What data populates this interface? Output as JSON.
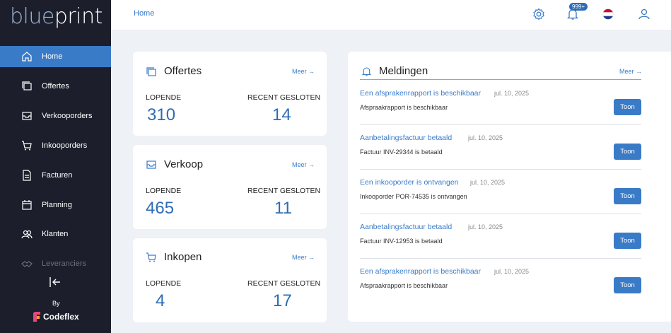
{
  "logo": {
    "part1": "blue",
    "part2": "print"
  },
  "sidebar": {
    "items": [
      {
        "label": "Home"
      },
      {
        "label": "Offertes"
      },
      {
        "label": "Verkooporders"
      },
      {
        "label": "Inkooporders"
      },
      {
        "label": "Facturen"
      },
      {
        "label": "Planning"
      },
      {
        "label": "Klanten"
      },
      {
        "label": "Leveranciers"
      }
    ],
    "by_label": "By",
    "brand": "Codeflex"
  },
  "topbar": {
    "breadcrumb": "Home",
    "notif_badge": "999+"
  },
  "cards": [
    {
      "title": "Offertes",
      "meer": "Meer",
      "open_label": "LOPENDE",
      "open_value": "310",
      "closed_label": "RECENT GESLOTEN",
      "closed_value": "14"
    },
    {
      "title": "Verkoop",
      "meer": "Meer",
      "open_label": "LOPENDE",
      "open_value": "465",
      "closed_label": "RECENT GESLOTEN",
      "closed_value": "11"
    },
    {
      "title": "Inkopen",
      "meer": "Meer",
      "open_label": "LOPENDE",
      "open_value": "4",
      "closed_label": "RECENT GESLOTEN",
      "closed_value": "17"
    }
  ],
  "notifications": {
    "title": "Meldingen",
    "meer": "Meer",
    "button_label": "Toon",
    "items": [
      {
        "head": "Een afsprakenrapport is beschikbaar",
        "date": "jul. 10, 2025",
        "desc": "Afspraakrapport is beschikbaar"
      },
      {
        "head": "Aanbetalingsfactuur betaald",
        "date": "jul. 10, 2025",
        "desc": "Factuur INV-29344 is betaald"
      },
      {
        "head": "Een inkooporder is ontvangen",
        "date": "jul. 10, 2025",
        "desc": "Inkooporder POR-74535 is ontvangen"
      },
      {
        "head": "Aanbetalingsfactuur betaald",
        "date": "jul. 10, 2025",
        "desc": "Factuur INV-12953 is betaald"
      },
      {
        "head": "Een afsprakenrapport is beschikbaar",
        "date": "jul. 10, 2025",
        "desc": "Afspraakrapport is beschikbaar"
      }
    ]
  }
}
